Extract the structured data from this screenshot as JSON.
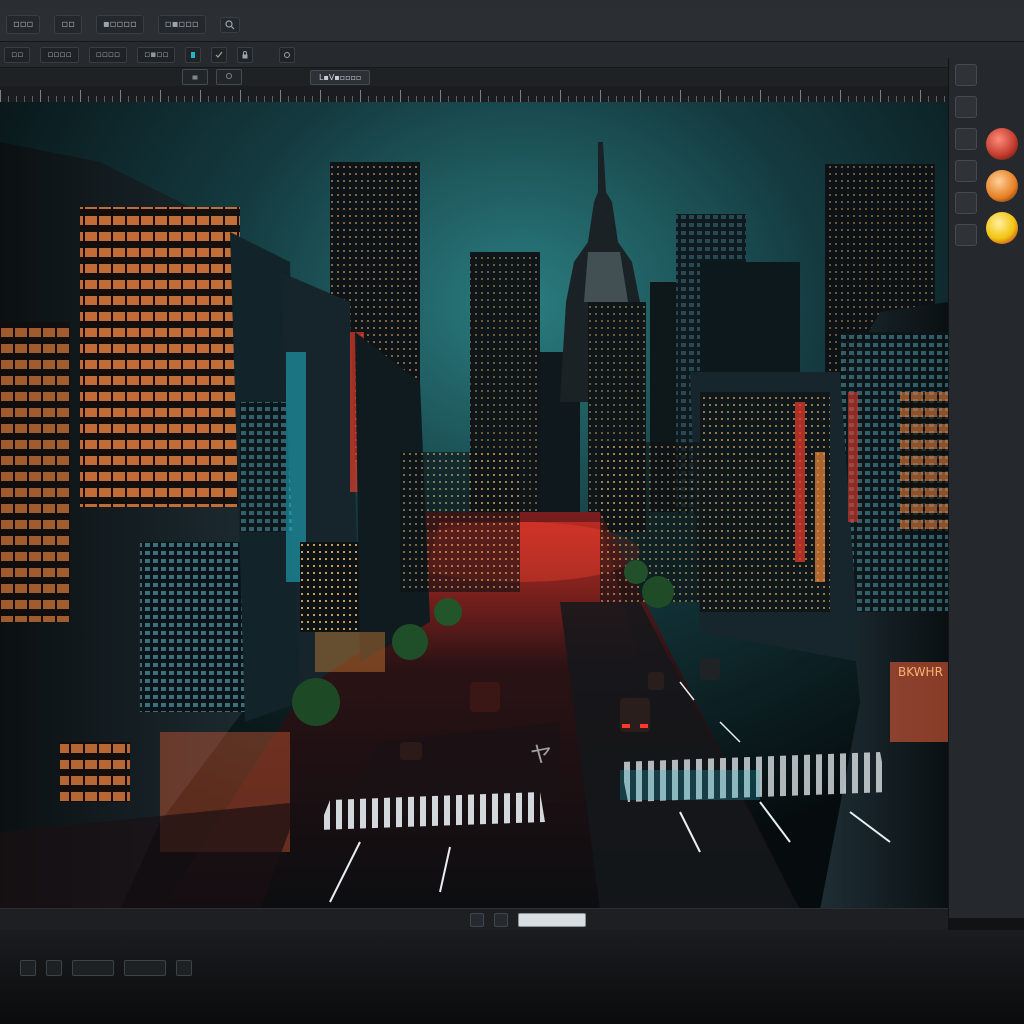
{
  "app": {
    "document_tab": "L▪V▪▫▫▫▫",
    "inactive_tab": ""
  },
  "menubar": {
    "items": [
      "▫▫▫",
      "▫▫",
      "▪▫▫▫▫",
      "▫▪▫▫▫",
      "",
      "▫▪"
    ]
  },
  "options_bar": {
    "items": [
      "▫▫",
      "▫▫▫▫",
      "▫▫▫▫",
      "▫▪▫▫",
      "▫▫▫",
      "▪▫▫▫▫▫",
      "",
      "",
      "",
      ""
    ]
  },
  "canvas": {
    "image_subject": "night-city-street",
    "sign_text": [
      "BKWHR",
      "ヤ"
    ]
  },
  "colors": {
    "ui_dark": "#25282c",
    "accent_teal": "#1fb6c8",
    "accent_red": "#e23a2a",
    "swatch_colors": [
      "#c0392b",
      "#e67e22",
      "#f1c40f"
    ]
  }
}
